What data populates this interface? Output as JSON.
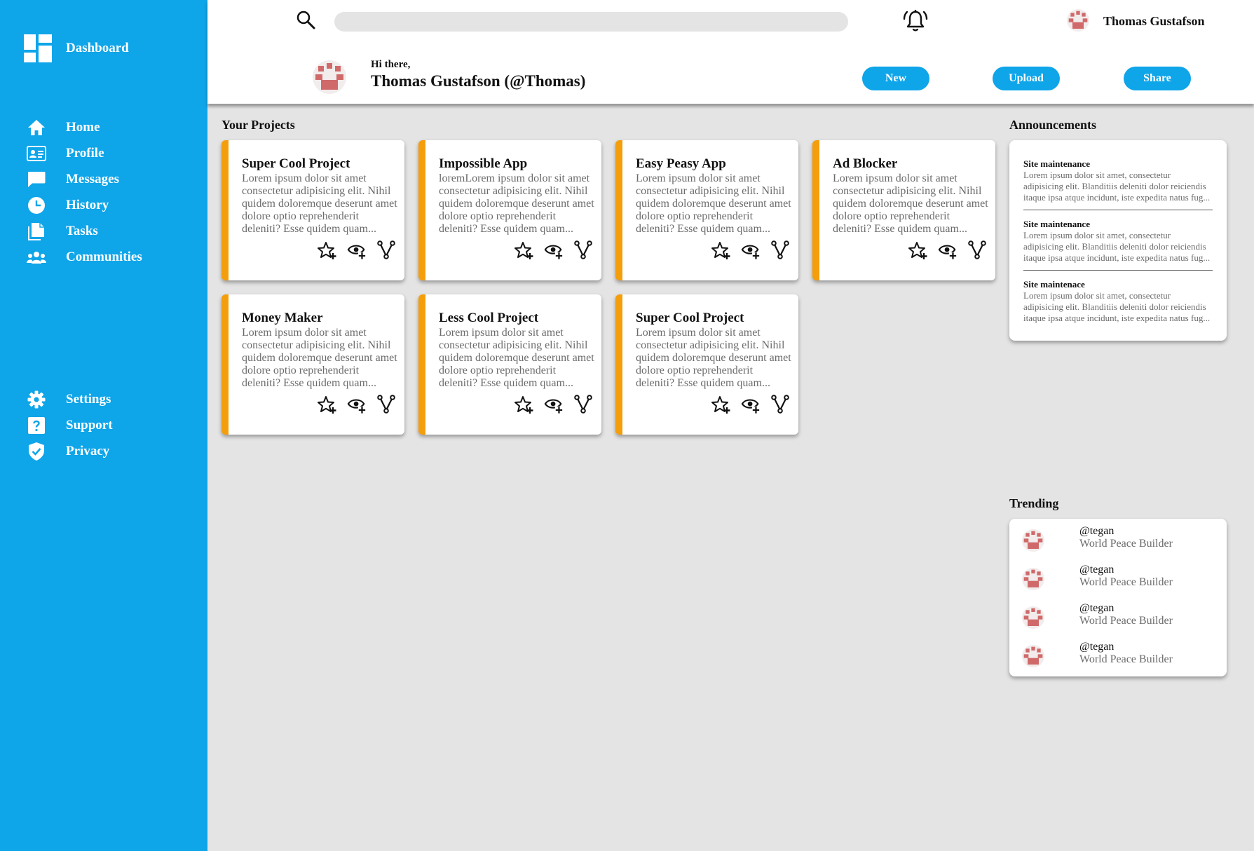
{
  "sidebar": {
    "brand_label": "Dashboard",
    "brand_icon": "dashboard-icon",
    "primary_items": [
      {
        "label": "Home",
        "icon": "home-icon"
      },
      {
        "label": "Profile",
        "icon": "id-card-icon"
      },
      {
        "label": "Messages",
        "icon": "chat-bubble-icon"
      },
      {
        "label": "History",
        "icon": "clock-icon"
      },
      {
        "label": "Tasks",
        "icon": "documents-icon"
      },
      {
        "label": "Communities",
        "icon": "people-icon"
      }
    ],
    "secondary_items": [
      {
        "label": "Settings",
        "icon": "gear-icon"
      },
      {
        "label": "Support",
        "icon": "question-icon"
      },
      {
        "label": "Privacy",
        "icon": "shield-check-icon"
      }
    ]
  },
  "header": {
    "search_placeholder": "",
    "username": "Thomas Gustafson",
    "greeting": "Hi there,",
    "fullname": "Thomas Gustafson (@Thomas)",
    "buttons": {
      "new": "New",
      "upload": "Upload",
      "share": "Share"
    }
  },
  "projects": {
    "title": "Your Projects",
    "items": [
      {
        "title": "Super Cool Project",
        "desc": "Lorem ipsum dolor sit amet consectetur adipisicing elit. Nihil quidem doloremque deserunt amet dolore optio reprehenderit deleniti? Esse quidem quam..."
      },
      {
        "title": "Impossible App",
        "desc": "loremLorem ipsum dolor sit amet consectetur adipisicing elit. Nihil quidem doloremque deserunt amet dolore optio reprehenderit deleniti? Esse quidem quam..."
      },
      {
        "title": "Easy Peasy App",
        "desc": "Lorem ipsum dolor sit amet consectetur adipisicing elit. Nihil quidem doloremque deserunt amet dolore optio reprehenderit deleniti? Esse quidem quam..."
      },
      {
        "title": "Ad Blocker",
        "desc": "Lorem ipsum dolor sit amet consectetur adipisicing elit. Nihil quidem doloremque deserunt amet dolore optio reprehenderit deleniti? Esse quidem quam..."
      },
      {
        "title": "Money Maker",
        "desc": "Lorem ipsum dolor sit amet consectetur adipisicing elit. Nihil quidem doloremque deserunt amet dolore optio reprehenderit deleniti? Esse quidem quam..."
      },
      {
        "title": "Less Cool Project",
        "desc": "Lorem ipsum dolor sit amet consectetur adipisicing elit. Nihil quidem doloremque deserunt amet dolore optio reprehenderit deleniti? Esse quidem quam..."
      },
      {
        "title": "Super Cool Project",
        "desc": "Lorem ipsum dolor sit amet consectetur adipisicing elit. Nihil quidem doloremque deserunt amet dolore optio reprehenderit deleniti? Esse quidem quam..."
      }
    ]
  },
  "announcements": {
    "title": "Announcements",
    "items": [
      {
        "title": "Site maintenance",
        "body": "Lorem ipsum dolor sit amet, consectetur adipisicing elit. Blanditiis deleniti dolor reiciendis itaque ipsa atque incidunt, iste expedita natus fug..."
      },
      {
        "title": "Site maintenance",
        "body": "Lorem ipsum dolor sit amet, consectetur adipisicing elit. Blanditiis deleniti dolor reiciendis itaque ipsa atque incidunt, iste expedita natus fug..."
      },
      {
        "title": "Site maintenace",
        "body": "Lorem ipsum dolor sit amet, consectetur adipisicing elit. Blanditiis deleniti dolor reiciendis itaque ipsa atque incidunt, iste expedita natus fug..."
      }
    ]
  },
  "trending": {
    "title": "Trending",
    "items": [
      {
        "handle": "@tegan",
        "role": "World Peace Builder"
      },
      {
        "handle": "@tegan",
        "role": "World Peace Builder"
      },
      {
        "handle": "@tegan",
        "role": "World Peace Builder"
      },
      {
        "handle": "@tegan",
        "role": "World Peace Builder"
      }
    ]
  },
  "colors": {
    "accent": "#0ea5e9",
    "card_stripe": "#f59e0b",
    "background": "#e4e4e4"
  }
}
